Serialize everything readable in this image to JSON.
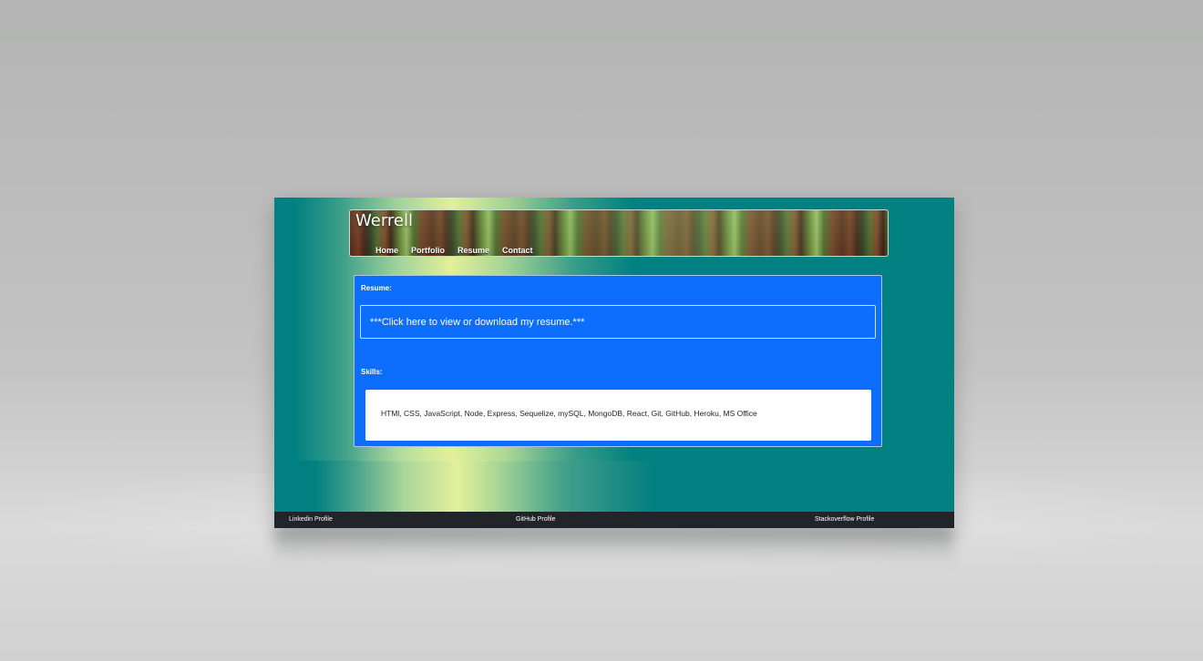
{
  "site": {
    "title": "Werrell"
  },
  "nav": {
    "items": [
      {
        "label": "Home"
      },
      {
        "label": "Portfolio"
      },
      {
        "label": "Resume"
      },
      {
        "label": "Contact"
      }
    ]
  },
  "main": {
    "resume_label": "Resume:",
    "resume_link": "***Click here to view or download my resume.***",
    "skills_label": "Skills:",
    "skills_text": "HTMl, CSS, JavaScript, Node, Express, Sequelize, mySQL, MongoDB, React, Git, GitHub, Heroku, MS Office"
  },
  "footer": {
    "links": [
      {
        "label": "Linkedin Profile"
      },
      {
        "label": "GitHub Profile"
      },
      {
        "label": "Stackoverflow Profile"
      }
    ]
  },
  "colors": {
    "page_bg": "#008080",
    "card_bg": "#0d6efd",
    "footer_bg": "#212529",
    "gradient_highlight": "#e3f09a"
  }
}
